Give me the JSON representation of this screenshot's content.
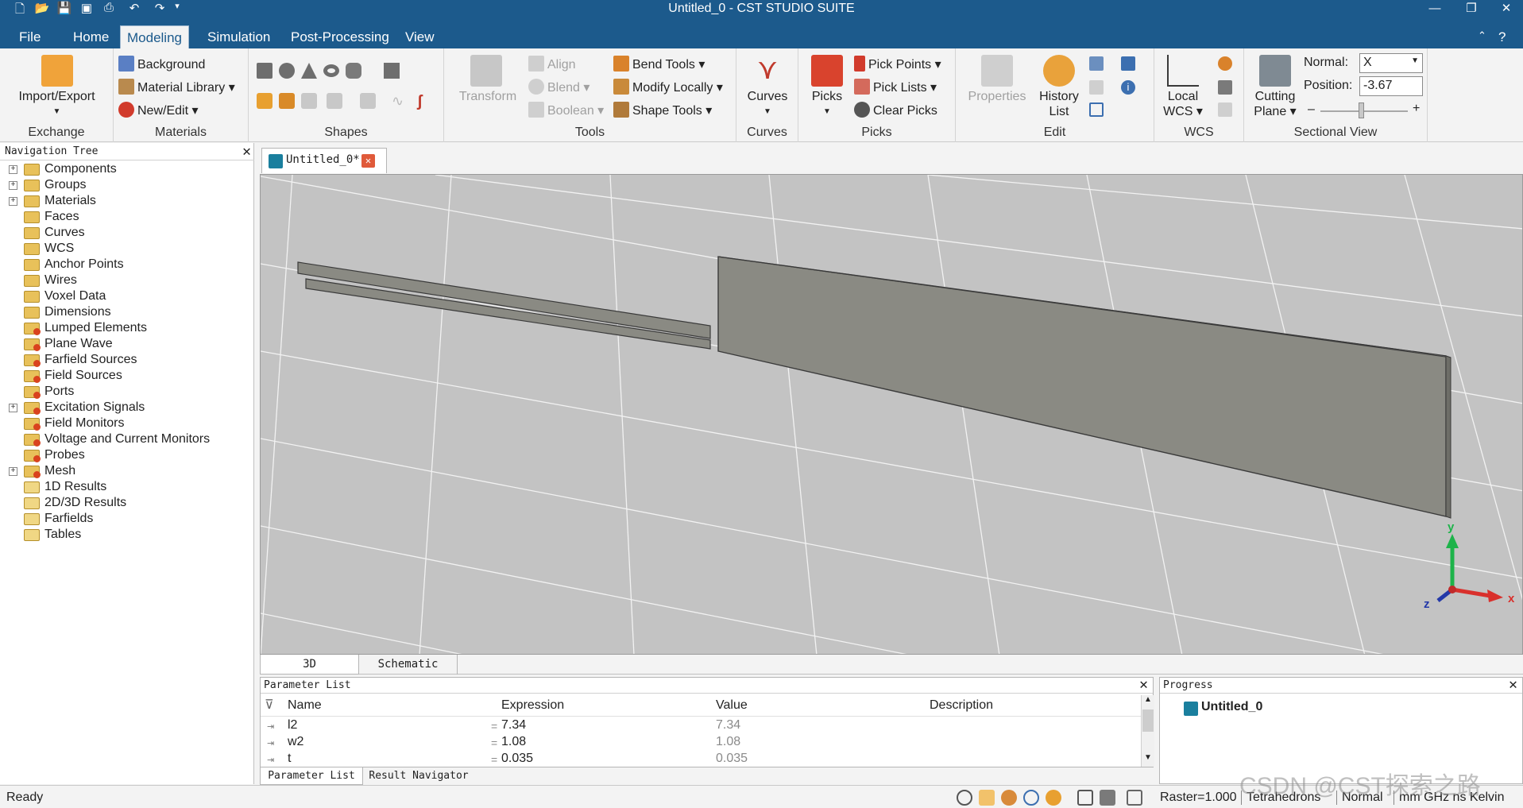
{
  "window": {
    "title": "Untitled_0 - CST STUDIO SUITE"
  },
  "menu": {
    "file": "File",
    "tabs": [
      "Home",
      "Modeling",
      "Simulation",
      "Post-Processing",
      "View"
    ]
  },
  "ribbon": {
    "exchange": {
      "import_export": "Import/Export",
      "label": "Exchange"
    },
    "materials": {
      "background": "Background",
      "material_library": "Material Library",
      "new_edit": "New/Edit",
      "label": "Materials"
    },
    "shapes": {
      "label": "Shapes"
    },
    "tools": {
      "transform": "Transform",
      "align": "Align",
      "blend": "Blend",
      "boolean": "Boolean",
      "bend_tools": "Bend Tools",
      "modify_locally": "Modify Locally",
      "shape_tools": "Shape Tools",
      "label": "Tools"
    },
    "curves": {
      "curves": "Curves",
      "label": "Curves"
    },
    "picks": {
      "picks": "Picks",
      "pick_points": "Pick Points",
      "pick_lists": "Pick Lists",
      "clear_picks": "Clear Picks",
      "label": "Picks"
    },
    "edit": {
      "properties": "Properties",
      "history": "History",
      "list": "List",
      "label": "Edit"
    },
    "wcs": {
      "local": "Local",
      "wcs": "WCS",
      "label": "WCS"
    },
    "sectional": {
      "cutting": "Cutting",
      "plane": "Plane",
      "normal_label": "Normal:",
      "normal_value": "X",
      "position_label": "Position:",
      "position_value": "-3.67",
      "label": "Sectional View"
    }
  },
  "navtree": {
    "title": "Navigation Tree",
    "items": [
      {
        "label": "Components",
        "expandable": true,
        "icon": "folder"
      },
      {
        "label": "Groups",
        "expandable": true,
        "icon": "folder"
      },
      {
        "label": "Materials",
        "expandable": true,
        "icon": "folder"
      },
      {
        "label": "Faces",
        "expandable": false,
        "icon": "folder"
      },
      {
        "label": "Curves",
        "expandable": false,
        "icon": "folder"
      },
      {
        "label": "WCS",
        "expandable": false,
        "icon": "folder"
      },
      {
        "label": "Anchor Points",
        "expandable": false,
        "icon": "folder"
      },
      {
        "label": "Wires",
        "expandable": false,
        "icon": "folder"
      },
      {
        "label": "Voxel Data",
        "expandable": false,
        "icon": "folder"
      },
      {
        "label": "Dimensions",
        "expandable": false,
        "icon": "folder"
      },
      {
        "label": "Lumped Elements",
        "expandable": false,
        "icon": "folder-red"
      },
      {
        "label": "Plane Wave",
        "expandable": false,
        "icon": "folder-red"
      },
      {
        "label": "Farfield Sources",
        "expandable": false,
        "icon": "folder-red"
      },
      {
        "label": "Field Sources",
        "expandable": false,
        "icon": "folder-red"
      },
      {
        "label": "Ports",
        "expandable": false,
        "icon": "folder-red"
      },
      {
        "label": "Excitation Signals",
        "expandable": true,
        "icon": "folder-red"
      },
      {
        "label": "Field Monitors",
        "expandable": false,
        "icon": "folder-red"
      },
      {
        "label": "Voltage and Current Monitors",
        "expandable": false,
        "icon": "folder-red"
      },
      {
        "label": "Probes",
        "expandable": false,
        "icon": "folder-red"
      },
      {
        "label": "Mesh",
        "expandable": true,
        "icon": "folder-red"
      },
      {
        "label": "1D Results",
        "expandable": false,
        "icon": "folder-result"
      },
      {
        "label": "2D/3D Results",
        "expandable": false,
        "icon": "folder-result"
      },
      {
        "label": "Farfields",
        "expandable": false,
        "icon": "folder-result"
      },
      {
        "label": "Tables",
        "expandable": false,
        "icon": "folder-result"
      }
    ]
  },
  "document": {
    "tab": "Untitled_0*"
  },
  "view_tabs": [
    "3D",
    "Schematic"
  ],
  "axes": {
    "x": "x",
    "y": "y",
    "z": "z"
  },
  "params": {
    "title": "Parameter List",
    "columns": [
      "Name",
      "Expression",
      "Value",
      "Description"
    ],
    "rows": [
      {
        "name": "l2",
        "expression": "7.34",
        "value": "7.34"
      },
      {
        "name": "w2",
        "expression": "1.08",
        "value": "1.08"
      },
      {
        "name": "t",
        "expression": "0.035",
        "value": "0.035"
      }
    ],
    "eq": "=",
    "tabs": [
      "Parameter List",
      "Result Navigator"
    ]
  },
  "progress": {
    "title": "Progress",
    "item": "Untitled_0"
  },
  "status": {
    "ready": "Ready",
    "raster": "Raster=1.000",
    "mesh": "Tetrahedrons",
    "mode": "Normal",
    "units": "mm  GHz  ns  Kelvin"
  },
  "watermark": "CSDN @CST探索之路",
  "colors": {
    "title_bar": "#1c5a8c",
    "viewport_bg": "#c3c3c3",
    "model_face": "#8a8a83"
  }
}
